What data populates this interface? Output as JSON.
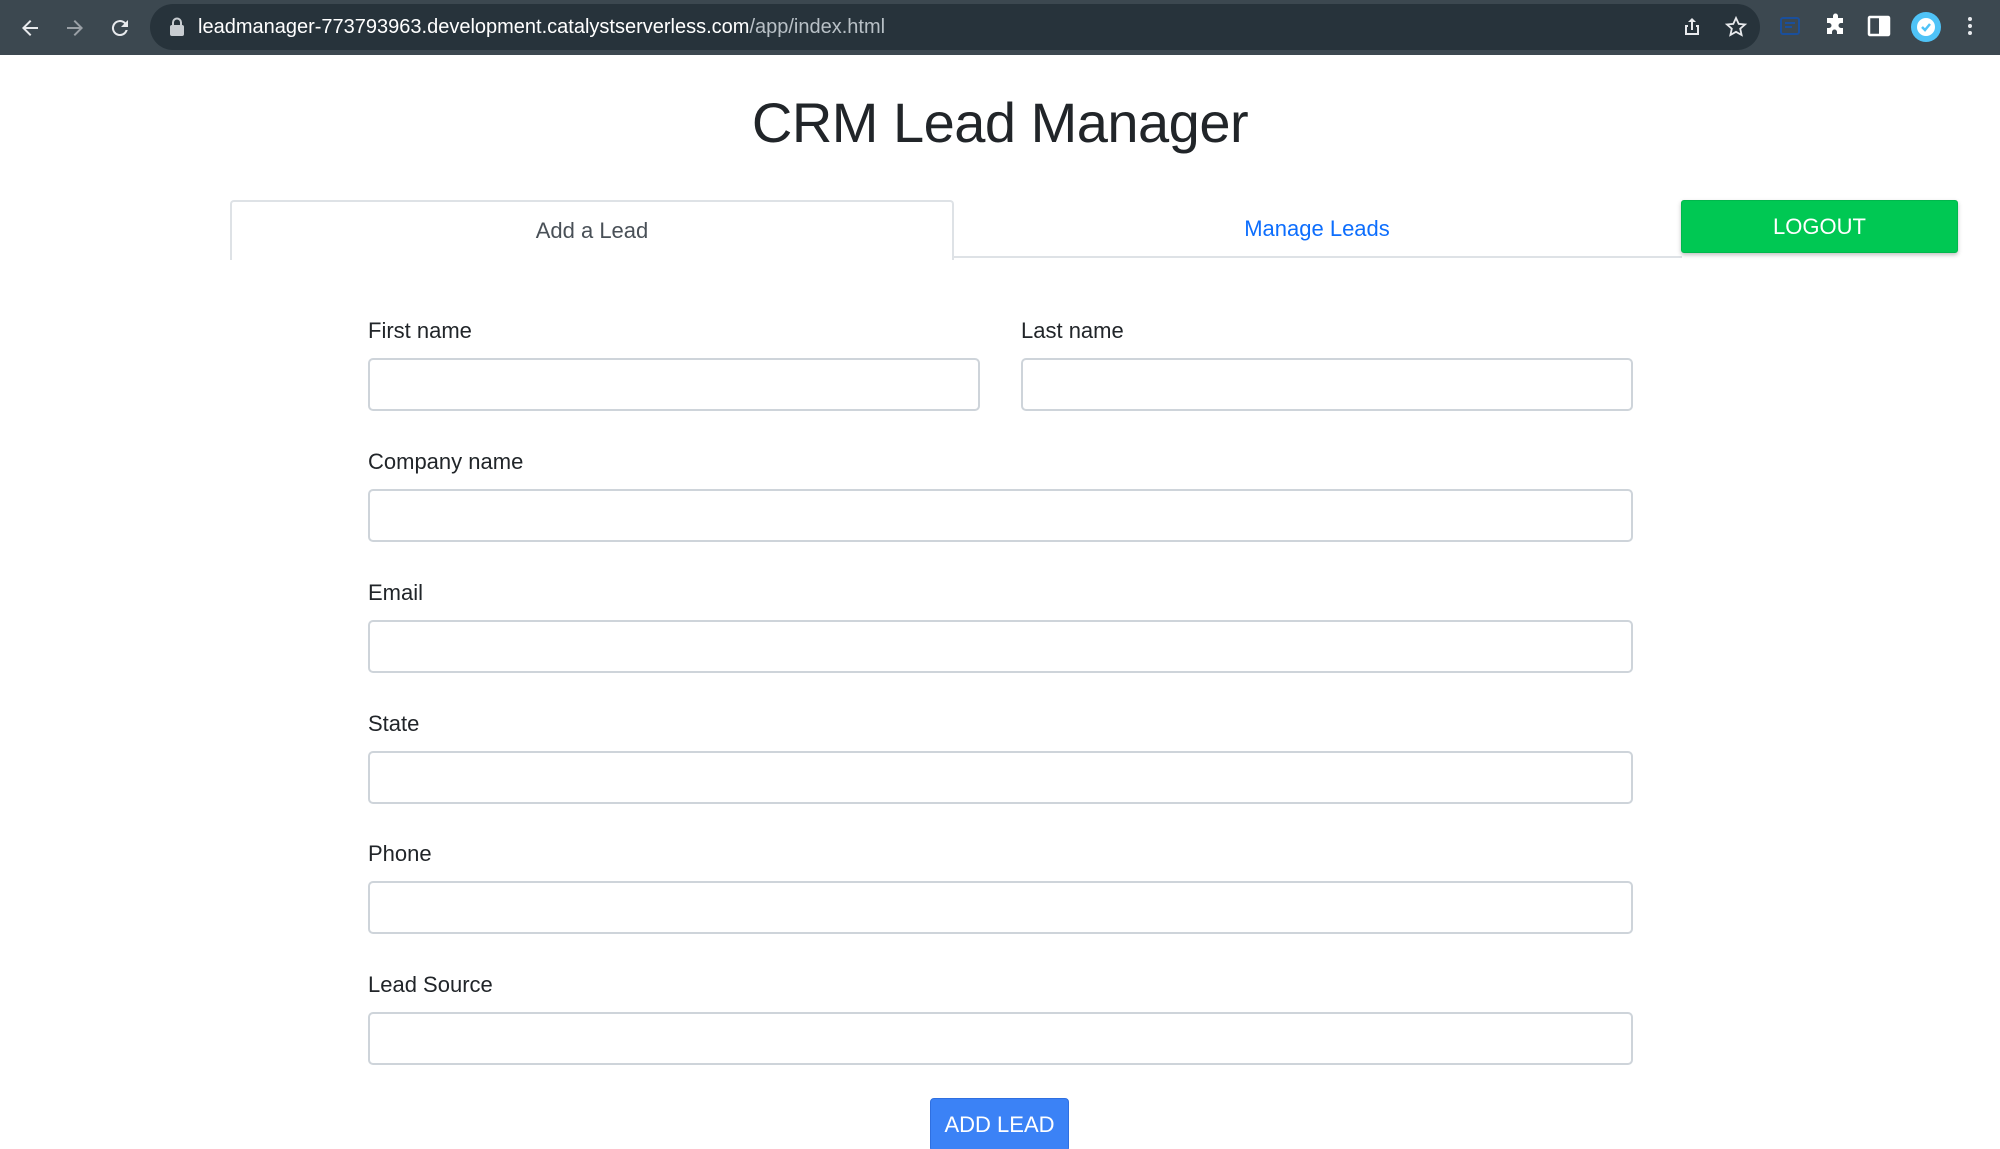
{
  "browser": {
    "url_host": "leadmanager-773793963.development.catalystserverless.com",
    "url_path": "/app/index.html",
    "icons": [
      "back-arrow-icon",
      "forward-arrow-icon",
      "reload-icon",
      "lock-icon",
      "share-icon",
      "star-icon",
      "extension-icon",
      "puzzle-icon",
      "side-panel-icon",
      "profile-avatar-icon",
      "more-menu-icon"
    ]
  },
  "page": {
    "title": "CRM Lead Manager"
  },
  "tabs": {
    "add_label": "Add a Lead",
    "manage_label": "Manage Leads",
    "logout_label": "LOGOUT"
  },
  "form": {
    "first_name_label": "First name",
    "last_name_label": "Last name",
    "company_label": "Company name",
    "email_label": "Email",
    "state_label": "State",
    "phone_label": "Phone",
    "lead_source_label": "Lead Source",
    "submit_label": "ADD LEAD"
  },
  "colors": {
    "logout_green": "#00c853",
    "add_blue": "#3b82f6",
    "link_blue": "#0d6efd",
    "chrome_dark": "#3c4850"
  }
}
